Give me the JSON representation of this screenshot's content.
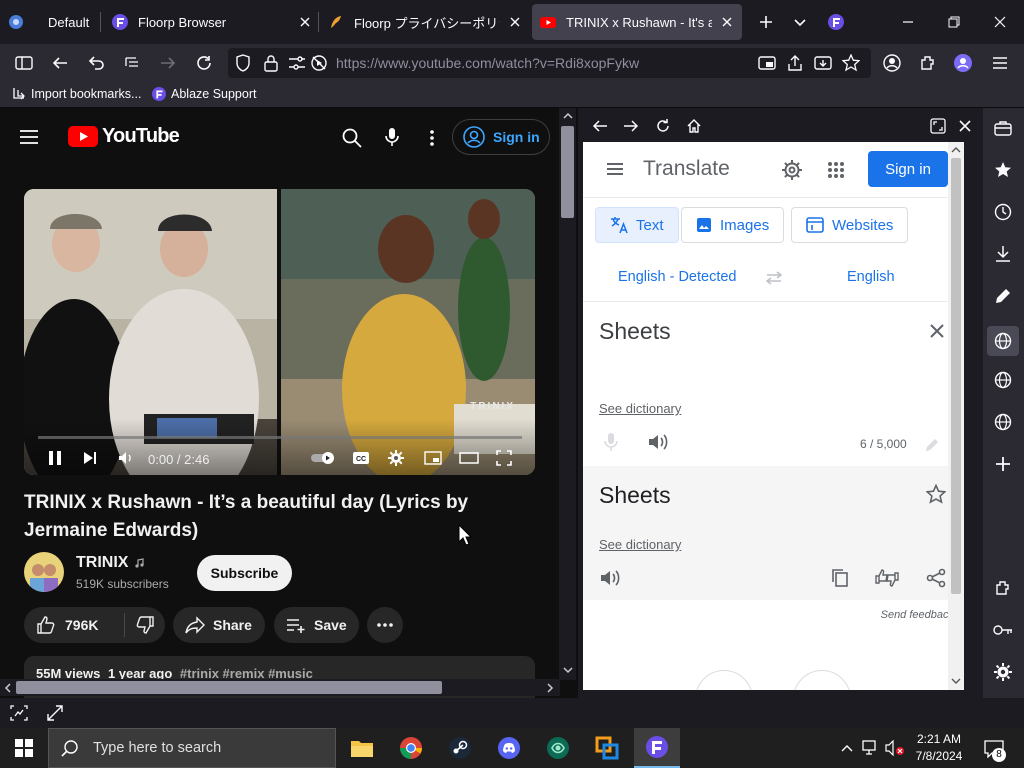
{
  "browser": {
    "tabs": [
      {
        "title": "Default"
      },
      {
        "title": "Floorp Browser"
      },
      {
        "title": "Floorp プライバシーポリシー"
      },
      {
        "title": "TRINIX x Rushawn - It's a beau"
      }
    ],
    "url": "https://www.youtube.com/watch?v=Rdi8xopFykw",
    "bookmarks": [
      {
        "label": "Import bookmarks..."
      },
      {
        "label": "Ablaze Support"
      }
    ]
  },
  "youtube": {
    "logo": "YouTube",
    "sign_in": "Sign in",
    "player": {
      "time": "0:00 / 2:46",
      "watermark": "TRINIX",
      "progress": 0
    },
    "video_title": "TRINIX x Rushawn - It’s a beautiful day (Lyrics by Jermaine Edwards)",
    "channel": "TRINIX",
    "subscribers": "519K subscribers",
    "subscribe": "Subscribe",
    "likes": "796K",
    "share": "Share",
    "save": "Save",
    "views": "55M views",
    "age": "1 year ago",
    "hashtags": "#trinix #remix #music"
  },
  "translate": {
    "title": "Translate",
    "sign_in": "Sign in",
    "modes": [
      {
        "label": "Text"
      },
      {
        "label": "Images"
      },
      {
        "label": "Websites"
      }
    ],
    "source_lang": "English - Detected",
    "target_lang": "English",
    "input_text": "Sheets",
    "see_dictionary": "See dictionary",
    "char_count": "6 / 5,000",
    "output_text": "Sheets",
    "send_feedback": "Send feedback"
  },
  "taskbar": {
    "search_placeholder": "Type here to search",
    "time": "2:21 AM",
    "date": "7/8/2024",
    "notifications": "8"
  },
  "colors": {
    "yt_red": "#ff0000",
    "google_blue": "#1a73e8",
    "floorp_purple": "#6b4ee6"
  }
}
